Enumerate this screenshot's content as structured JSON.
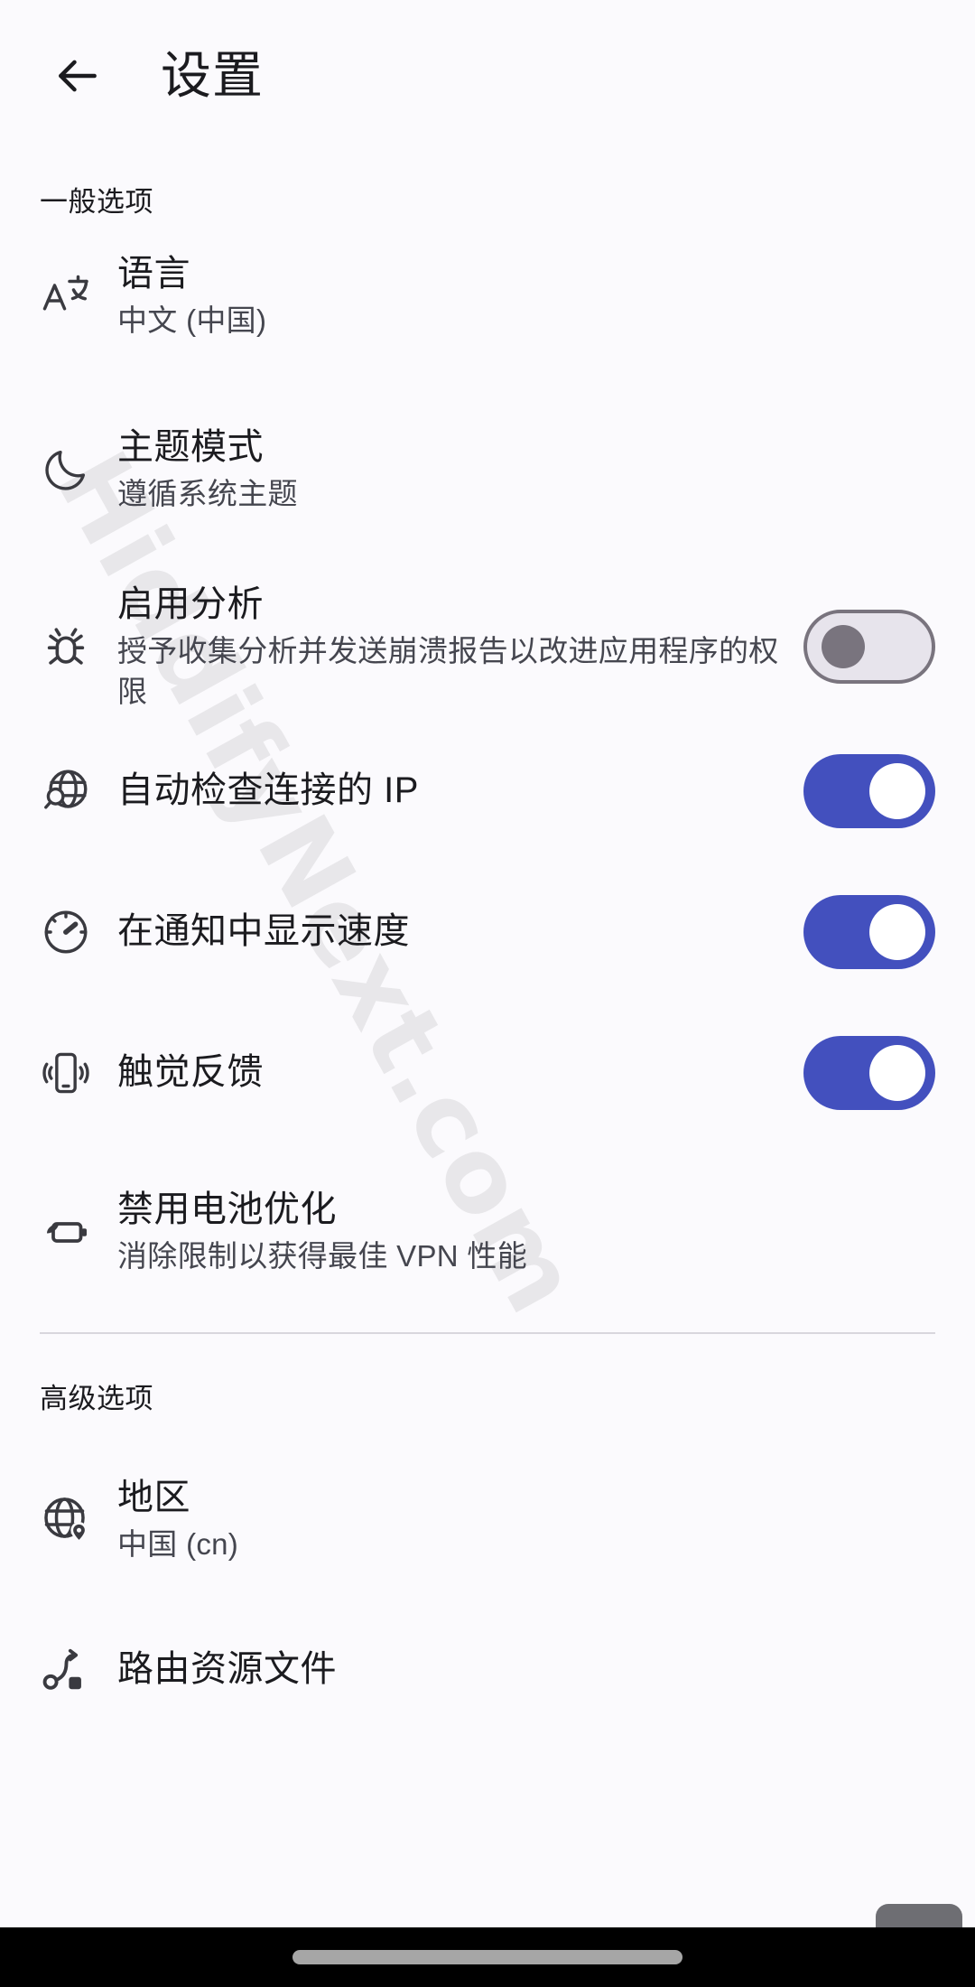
{
  "app": {
    "title": "设置",
    "back_icon": "arrow-left-icon",
    "accent_on_color": "#4350BE",
    "track_off_color": "#E7E4EC",
    "thumb_off_color": "#79747E",
    "background_color": "#FBFAFD",
    "navbar_color": "#000000"
  },
  "watermark": {
    "text": "HiddifyNext.com"
  },
  "sections": [
    {
      "header": "一般选项",
      "items": [
        {
          "icon": "translate-icon",
          "title": "语言",
          "subtitle": "中文 (中国)",
          "control": "none"
        },
        {
          "icon": "moon-icon",
          "title": "主题模式",
          "subtitle": "遵循系统主题",
          "control": "none"
        },
        {
          "icon": "bug-icon",
          "title": "启用分析",
          "subtitle": "授予收集分析并发送崩溃报告以改进应用程序的权限",
          "control": "switch",
          "switch_state": "off"
        },
        {
          "icon": "globe-search-icon",
          "title": "自动检查连接的 IP",
          "subtitle": "",
          "control": "switch",
          "switch_state": "on"
        },
        {
          "icon": "speedometer-icon",
          "title": "在通知中显示速度",
          "subtitle": "",
          "control": "switch",
          "switch_state": "on"
        },
        {
          "icon": "vibrate-icon",
          "title": "触觉反馈",
          "subtitle": "",
          "control": "switch",
          "switch_state": "on"
        },
        {
          "icon": "battery-saver-icon",
          "title": "禁用电池优化",
          "subtitle": "消除限制以获得最佳 VPN 性能",
          "control": "none"
        }
      ]
    },
    {
      "header": "高级选项",
      "items": [
        {
          "icon": "globe-pin-icon",
          "title": "地区",
          "subtitle": "中国 (cn)",
          "control": "none"
        },
        {
          "icon": "route-icon",
          "title": "路由资源文件",
          "subtitle": "",
          "control": "none"
        }
      ]
    }
  ],
  "navbar": {
    "home_indicator": "home-indicator"
  }
}
